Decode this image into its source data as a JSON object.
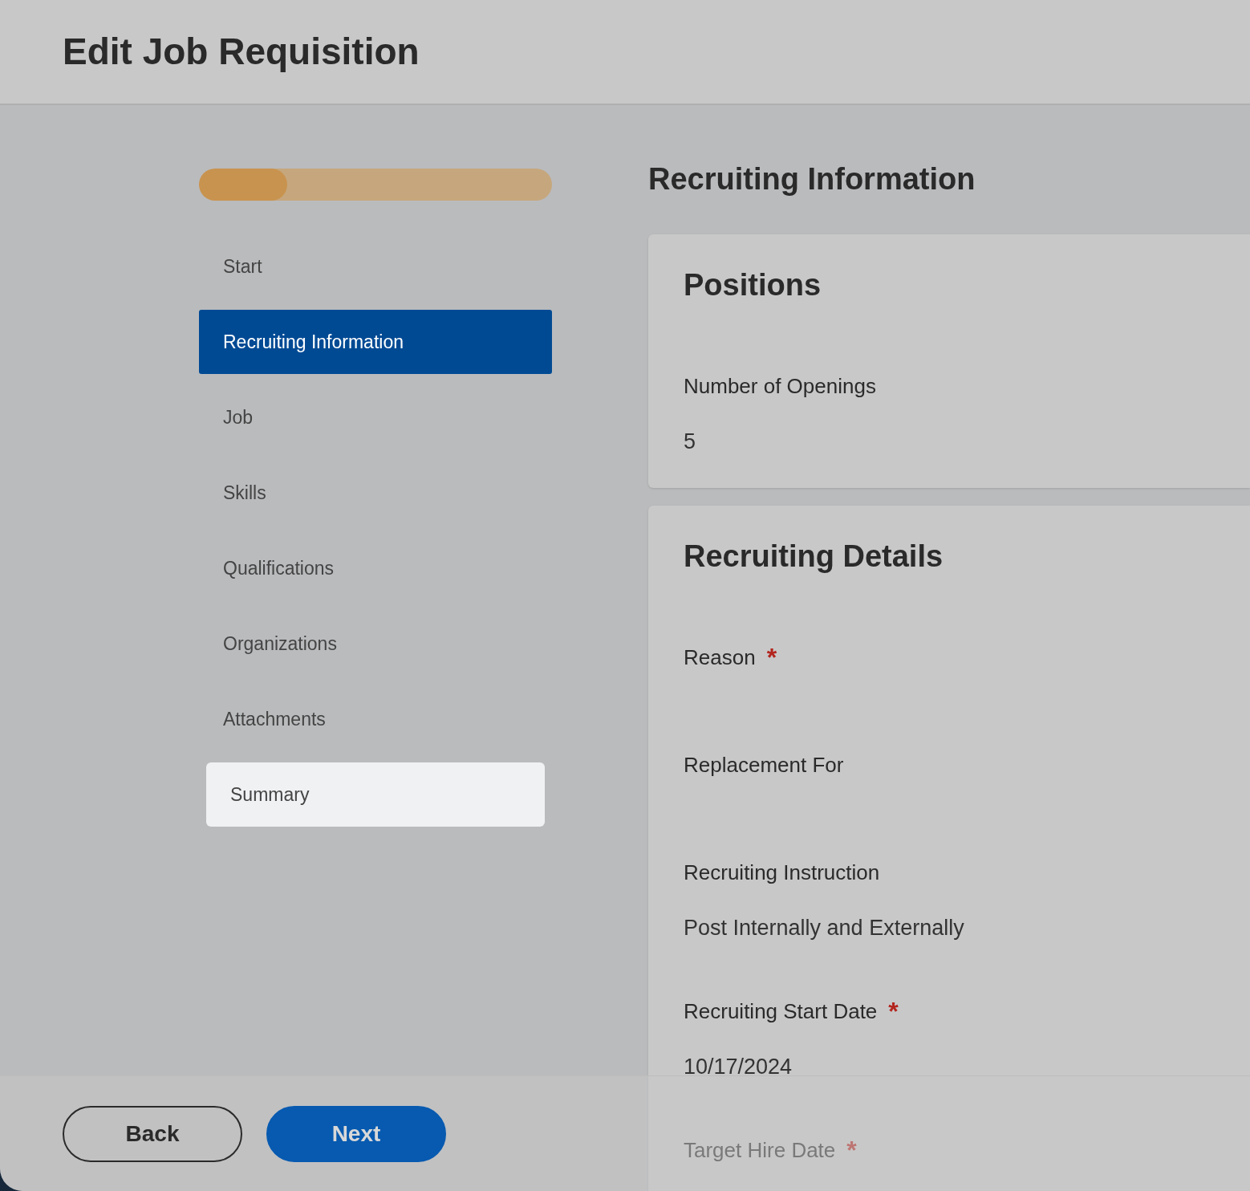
{
  "page_title": "Edit Job Requisition",
  "progress": {
    "level": 0.25
  },
  "steps": [
    {
      "label": "Start",
      "selected": false,
      "focused": false
    },
    {
      "label": "Recruiting Information",
      "selected": true,
      "focused": false
    },
    {
      "label": "Job",
      "selected": false,
      "focused": false
    },
    {
      "label": "Skills",
      "selected": false,
      "focused": false
    },
    {
      "label": "Qualifications",
      "selected": false,
      "focused": false
    },
    {
      "label": "Organizations",
      "selected": false,
      "focused": false
    },
    {
      "label": "Attachments",
      "selected": false,
      "focused": false
    },
    {
      "label": "Summary",
      "selected": false,
      "focused": true
    }
  ],
  "section_title": "Recruiting Information",
  "cards": [
    {
      "title": "Positions",
      "fields": [
        {
          "label": "Number of Openings",
          "value": "5"
        }
      ]
    },
    {
      "title": "Recruiting Details",
      "fields": [
        {
          "label": "Reason",
          "required_mark": "*"
        },
        {
          "label": "Replacement For"
        },
        {
          "label": "Recruiting Instruction",
          "value": "Post Internally and Externally"
        },
        {
          "label": "Recruiting Start Date",
          "required_mark": "*",
          "value": "10/17/2024"
        },
        {
          "label": "Target Hire Date",
          "required_mark": "*"
        }
      ]
    }
  ],
  "buttons": [
    {
      "label": "Back",
      "kind": "secondary"
    },
    {
      "label": "Next",
      "kind": "primary"
    }
  ]
}
